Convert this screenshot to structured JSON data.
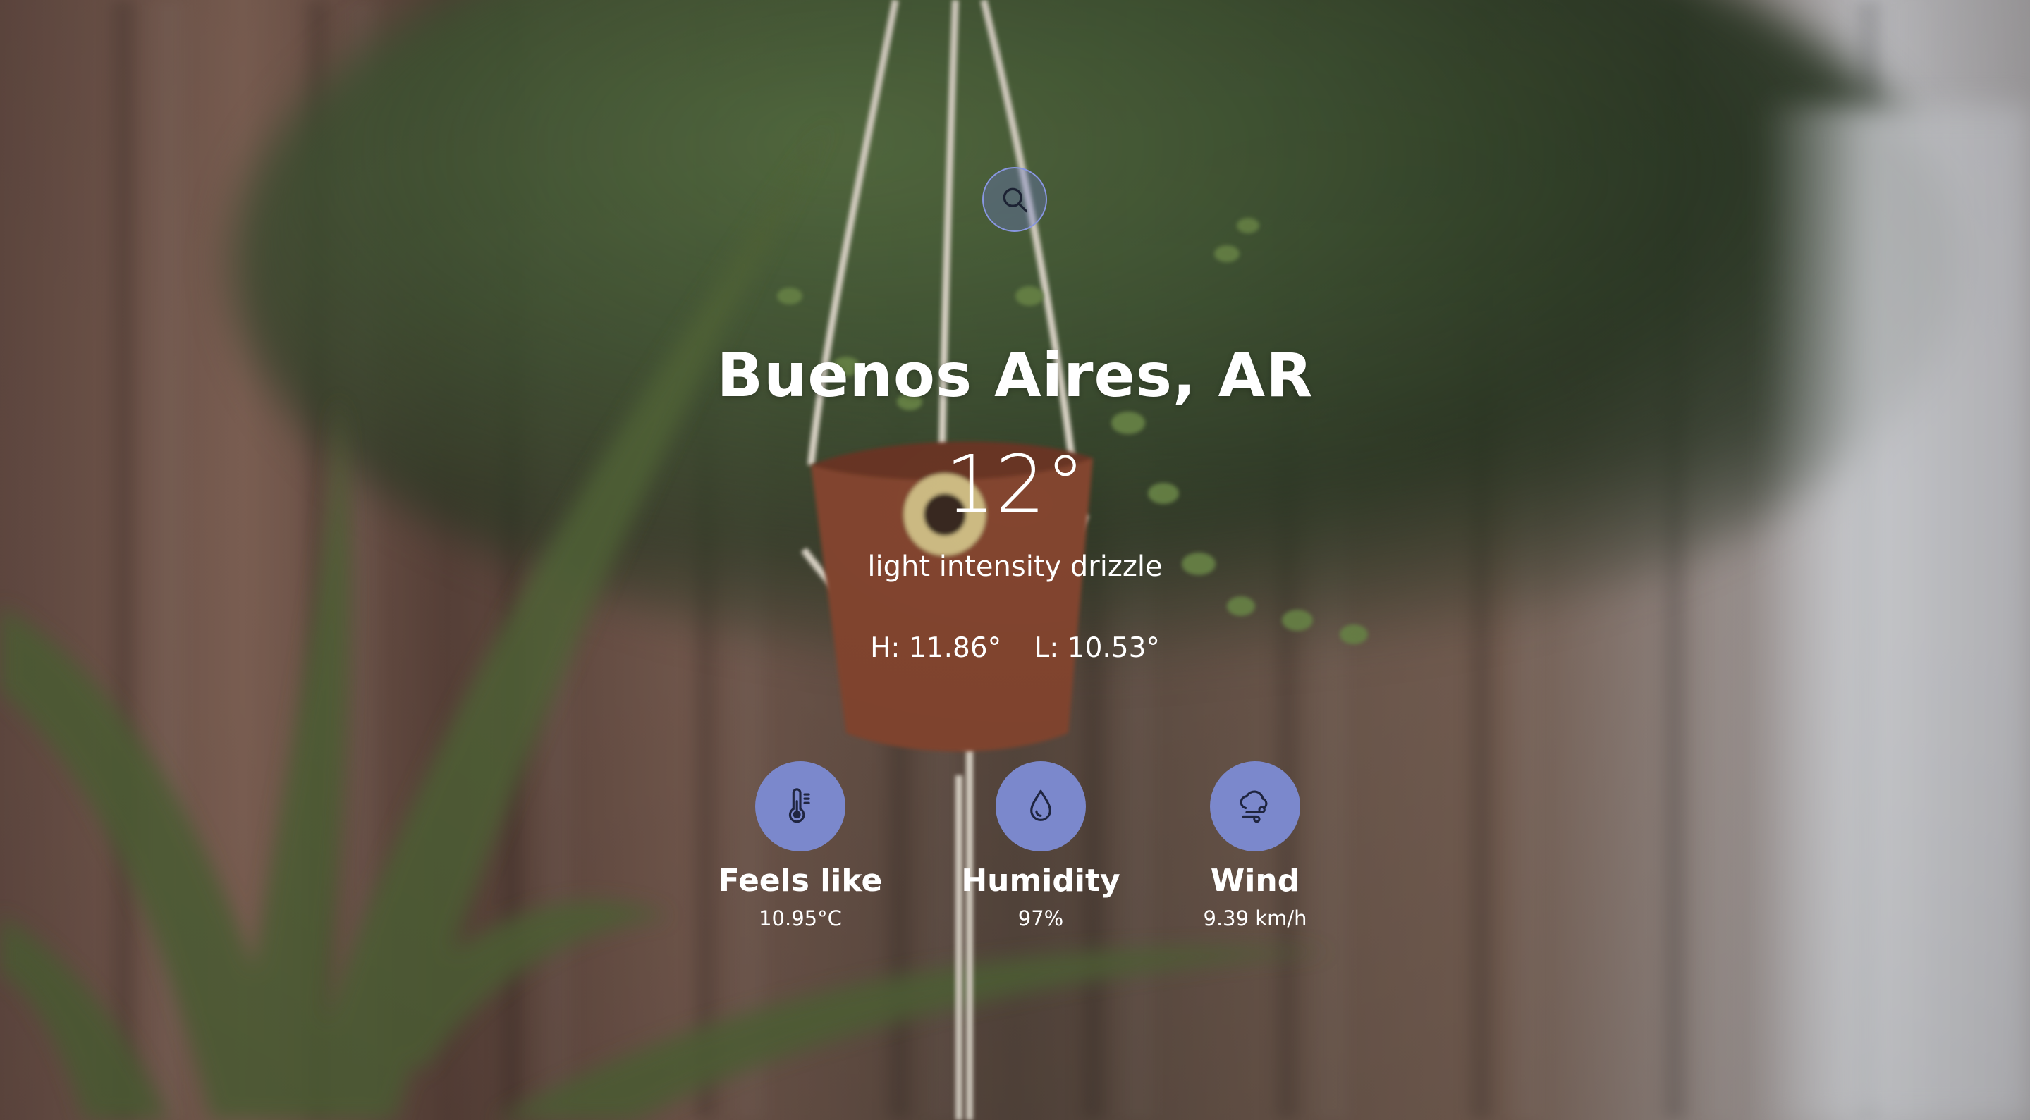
{
  "search": {
    "icon": "search-icon"
  },
  "location": {
    "name": "Buenos Aires, AR"
  },
  "current": {
    "temperature": "12°",
    "description": "light intensity drizzle",
    "high": "H: 11.86°",
    "low": "L: 10.53°"
  },
  "stats": [
    {
      "icon": "thermometer-icon",
      "label": "Feels like",
      "value": "10.95°C"
    },
    {
      "icon": "water-drop-icon",
      "label": "Humidity",
      "value": "97%"
    },
    {
      "icon": "wind-cloud-icon",
      "label": "Wind",
      "value": "9.39 km/h"
    }
  ],
  "colors": {
    "accent": "#7b88cc",
    "text": "#ffffff"
  }
}
